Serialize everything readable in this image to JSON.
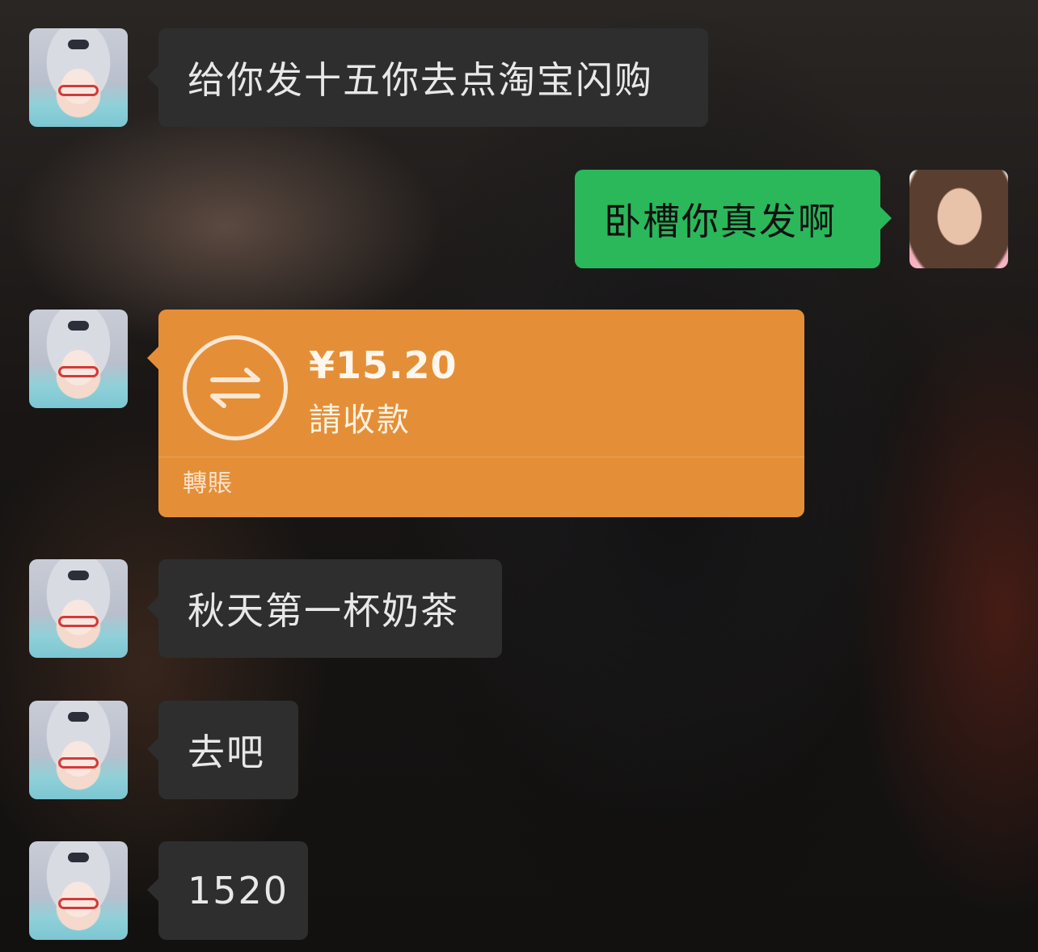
{
  "messages": [
    {
      "side": "in",
      "text": "给你发十五你去点淘宝闪购"
    },
    {
      "side": "out",
      "text": "卧槽你真发啊"
    },
    {
      "side": "in",
      "type": "transfer",
      "amount": "¥15.20",
      "status": "請收款",
      "label": "轉賬",
      "color": "#e48f38"
    },
    {
      "side": "in",
      "text": "秋天第一杯奶茶"
    },
    {
      "side": "in",
      "text": "去吧"
    },
    {
      "side": "in",
      "text": "1520"
    }
  ],
  "colors": {
    "incoming_bubble": "#2e2e2e",
    "outgoing_bubble": "#2ab85b",
    "transfer_card": "#e48f38"
  },
  "icons": [
    "doll-avatar-icon",
    "girl-avatar-icon",
    "transfer-arrows-icon"
  ]
}
